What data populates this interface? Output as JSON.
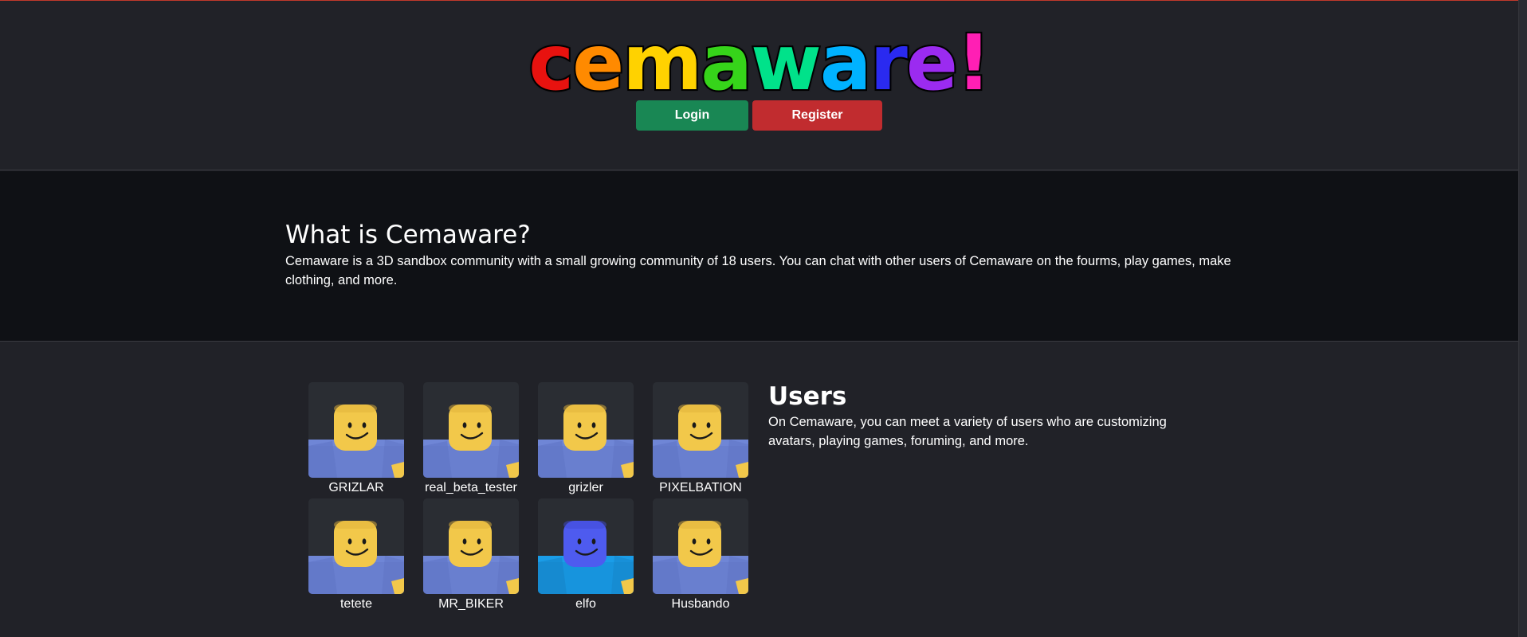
{
  "header": {
    "logo": {
      "text": "cemaware!",
      "letter_colors": [
        "#e8120f",
        "#ff8a00",
        "#ffd200",
        "#36d41a",
        "#00e28a",
        "#00b2ff",
        "#2a2af0",
        "#9b2bf0",
        "#ff1fb4"
      ]
    },
    "login_label": "Login",
    "register_label": "Register"
  },
  "about": {
    "title": "What is Cemaware?",
    "text": "Cemaware is a 3D sandbox community with a small growing community of 18 users. You can chat with other users of Cemaware on the fourms, play games, make clothing, and more."
  },
  "users": {
    "title": "Users",
    "text": "On Cemaware, you can meet a variety of users who are customizing avatars, playing games, foruming, and more.",
    "list": [
      {
        "name": "GRIZLAR",
        "avatar": "default-avatar-icon"
      },
      {
        "name": "real_beta_tester",
        "avatar": "default-avatar-icon"
      },
      {
        "name": "grizler",
        "avatar": "default-avatar-icon"
      },
      {
        "name": "PIXELBATION",
        "avatar": "default-avatar-icon"
      },
      {
        "name": "tetete",
        "avatar": "default-avatar-icon"
      },
      {
        "name": "MR_BIKER",
        "avatar": "default-avatar-icon"
      },
      {
        "name": "elfo",
        "avatar": "blue-avatar-icon"
      },
      {
        "name": "Husbando",
        "avatar": "default-avatar-icon"
      }
    ]
  },
  "colors": {
    "login_button": "#198754",
    "register_button": "#c12c2f",
    "page_background": "#212228",
    "about_background": "#0f1115"
  }
}
